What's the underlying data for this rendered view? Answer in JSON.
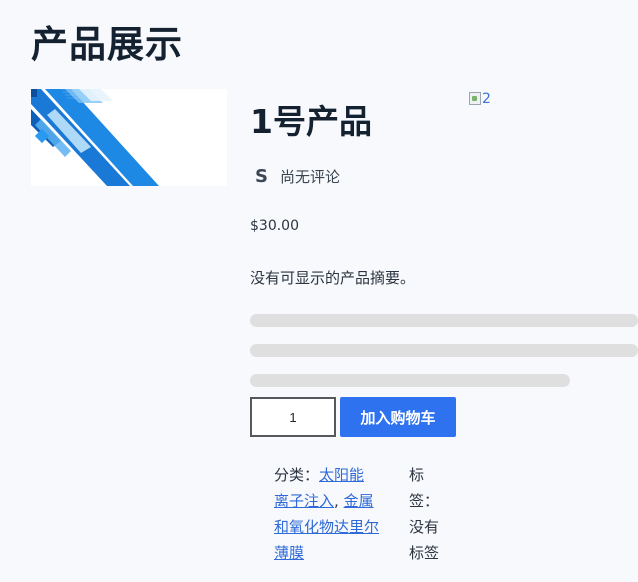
{
  "page": {
    "title": "产品展示"
  },
  "product": {
    "title": "1号产品",
    "broken_image_alt": "2",
    "rating_icon": "S",
    "rating_text": "尚无评论",
    "price": "$30.00",
    "summary": "没有可显示的产品摘要。",
    "quantity": "1",
    "add_to_cart_label": "加入购物车"
  },
  "meta": {
    "categories_label": "分类：",
    "categories": [
      "太阳能",
      "离子注入",
      "金属和氧化物达里尔薄膜"
    ],
    "separator": ", ",
    "tags_text": "标签：没有标签"
  },
  "colors": {
    "accent": "#2f72f0",
    "link": "#2f6ad8",
    "skeleton": "#dfdfdf",
    "background": "#f7f9fc"
  }
}
